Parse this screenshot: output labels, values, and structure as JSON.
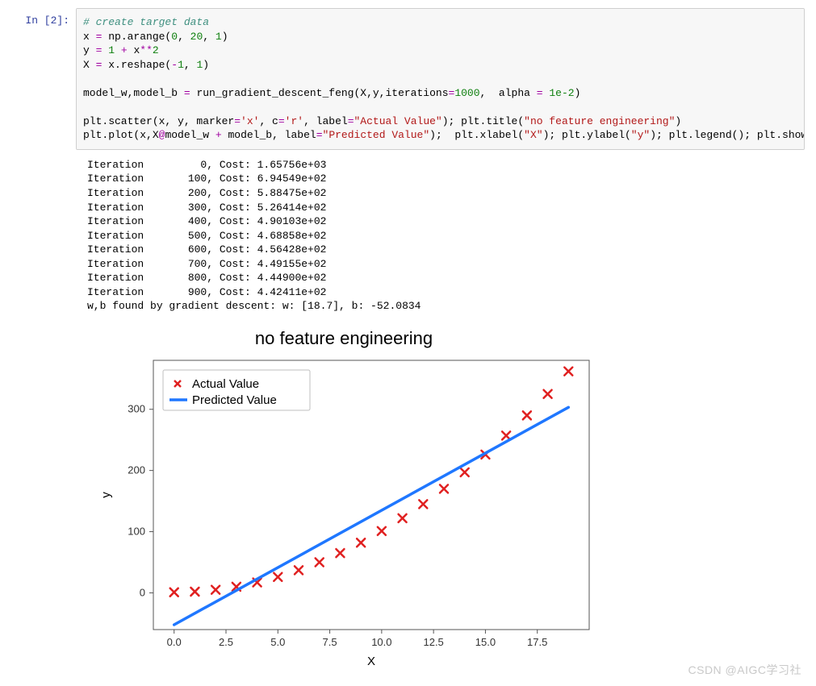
{
  "prompt": "In  [2]:",
  "code_tokens": [
    [
      [
        "# create target data",
        "comment"
      ]
    ],
    [
      [
        "x ",
        ""
      ],
      [
        "=",
        "op"
      ],
      [
        " np.arange(",
        ""
      ],
      [
        "0",
        "num"
      ],
      [
        ", ",
        ""
      ],
      [
        "20",
        "num"
      ],
      [
        ", ",
        ""
      ],
      [
        "1",
        "num"
      ],
      [
        ")",
        ""
      ]
    ],
    [
      [
        "y ",
        ""
      ],
      [
        "=",
        "op"
      ],
      [
        " ",
        ""
      ],
      [
        "1",
        "num"
      ],
      [
        " ",
        ""
      ],
      [
        "+",
        "op"
      ],
      [
        " x",
        ""
      ],
      [
        "**",
        "op"
      ],
      [
        "2",
        "num"
      ]
    ],
    [
      [
        "X ",
        ""
      ],
      [
        "=",
        "op"
      ],
      [
        " x.reshape(",
        ""
      ],
      [
        "-",
        "op"
      ],
      [
        "1",
        "num"
      ],
      [
        ", ",
        ""
      ],
      [
        "1",
        "num"
      ],
      [
        ")",
        ""
      ]
    ],
    [
      [
        "",
        ""
      ]
    ],
    [
      [
        "model_w,model_b ",
        ""
      ],
      [
        "=",
        "op"
      ],
      [
        " run_gradient_descent_feng(X,y,iterations",
        ""
      ],
      [
        "=",
        "op"
      ],
      [
        "1000",
        "num"
      ],
      [
        ",  alpha ",
        ""
      ],
      [
        "=",
        "op"
      ],
      [
        " ",
        ""
      ],
      [
        "1e-2",
        "num"
      ],
      [
        ")",
        ""
      ]
    ],
    [
      [
        "",
        ""
      ]
    ],
    [
      [
        "plt.scatter(x, y, marker",
        ""
      ],
      [
        "=",
        "op"
      ],
      [
        "'x'",
        "str"
      ],
      [
        ", c",
        ""
      ],
      [
        "=",
        "op"
      ],
      [
        "'r'",
        "str"
      ],
      [
        ", label",
        ""
      ],
      [
        "=",
        "op"
      ],
      [
        "\"Actual Value\"",
        "str"
      ],
      [
        "); plt.title(",
        ""
      ],
      [
        "\"no feature engineering\"",
        "str"
      ],
      [
        ")",
        ""
      ]
    ],
    [
      [
        "plt.plot(x,X",
        ""
      ],
      [
        "@",
        "op"
      ],
      [
        "model_w ",
        ""
      ],
      [
        "+",
        "op"
      ],
      [
        " model_b, label",
        ""
      ],
      [
        "=",
        "op"
      ],
      [
        "\"Predicted Value\"",
        "str"
      ],
      [
        ");  plt.xlabel(",
        ""
      ],
      [
        "\"X\"",
        "str"
      ],
      [
        "); plt.ylabel(",
        ""
      ],
      [
        "\"y\"",
        "str"
      ],
      [
        "); plt.legend(); plt.show()",
        ""
      ]
    ]
  ],
  "output_lines": [
    "Iteration         0, Cost: 1.65756e+03",
    "Iteration       100, Cost: 6.94549e+02",
    "Iteration       200, Cost: 5.88475e+02",
    "Iteration       300, Cost: 5.26414e+02",
    "Iteration       400, Cost: 4.90103e+02",
    "Iteration       500, Cost: 4.68858e+02",
    "Iteration       600, Cost: 4.56428e+02",
    "Iteration       700, Cost: 4.49155e+02",
    "Iteration       800, Cost: 4.44900e+02",
    "Iteration       900, Cost: 4.42411e+02",
    "w,b found by gradient descent: w: [18.7], b: -52.0834"
  ],
  "watermark": "CSDN @AIGC学习社",
  "chart_data": {
    "type": "scatter+line",
    "title": "no feature engineering",
    "xlabel": "X",
    "ylabel": "y",
    "xlim": [
      -1,
      20
    ],
    "ylim": [
      -60,
      380
    ],
    "xticks": [
      0.0,
      2.5,
      5.0,
      7.5,
      10.0,
      12.5,
      15.0,
      17.5
    ],
    "yticks": [
      0,
      100,
      200,
      300
    ],
    "series": [
      {
        "name": "Actual Value",
        "kind": "scatter",
        "color": "#e02020",
        "marker": "x",
        "x": [
          0,
          1,
          2,
          3,
          4,
          5,
          6,
          7,
          8,
          9,
          10,
          11,
          12,
          13,
          14,
          15,
          16,
          17,
          18,
          19
        ],
        "y": [
          1,
          2,
          5,
          10,
          17,
          26,
          37,
          50,
          65,
          82,
          101,
          122,
          145,
          170,
          197,
          226,
          257,
          290,
          325,
          362
        ]
      },
      {
        "name": "Predicted Value",
        "kind": "line",
        "color": "#1f77ff",
        "x": [
          0,
          19
        ],
        "y": [
          -52.08,
          303.22
        ]
      }
    ],
    "legend": {
      "position": "upper-left",
      "items": [
        "Actual Value",
        "Predicted Value"
      ]
    }
  }
}
